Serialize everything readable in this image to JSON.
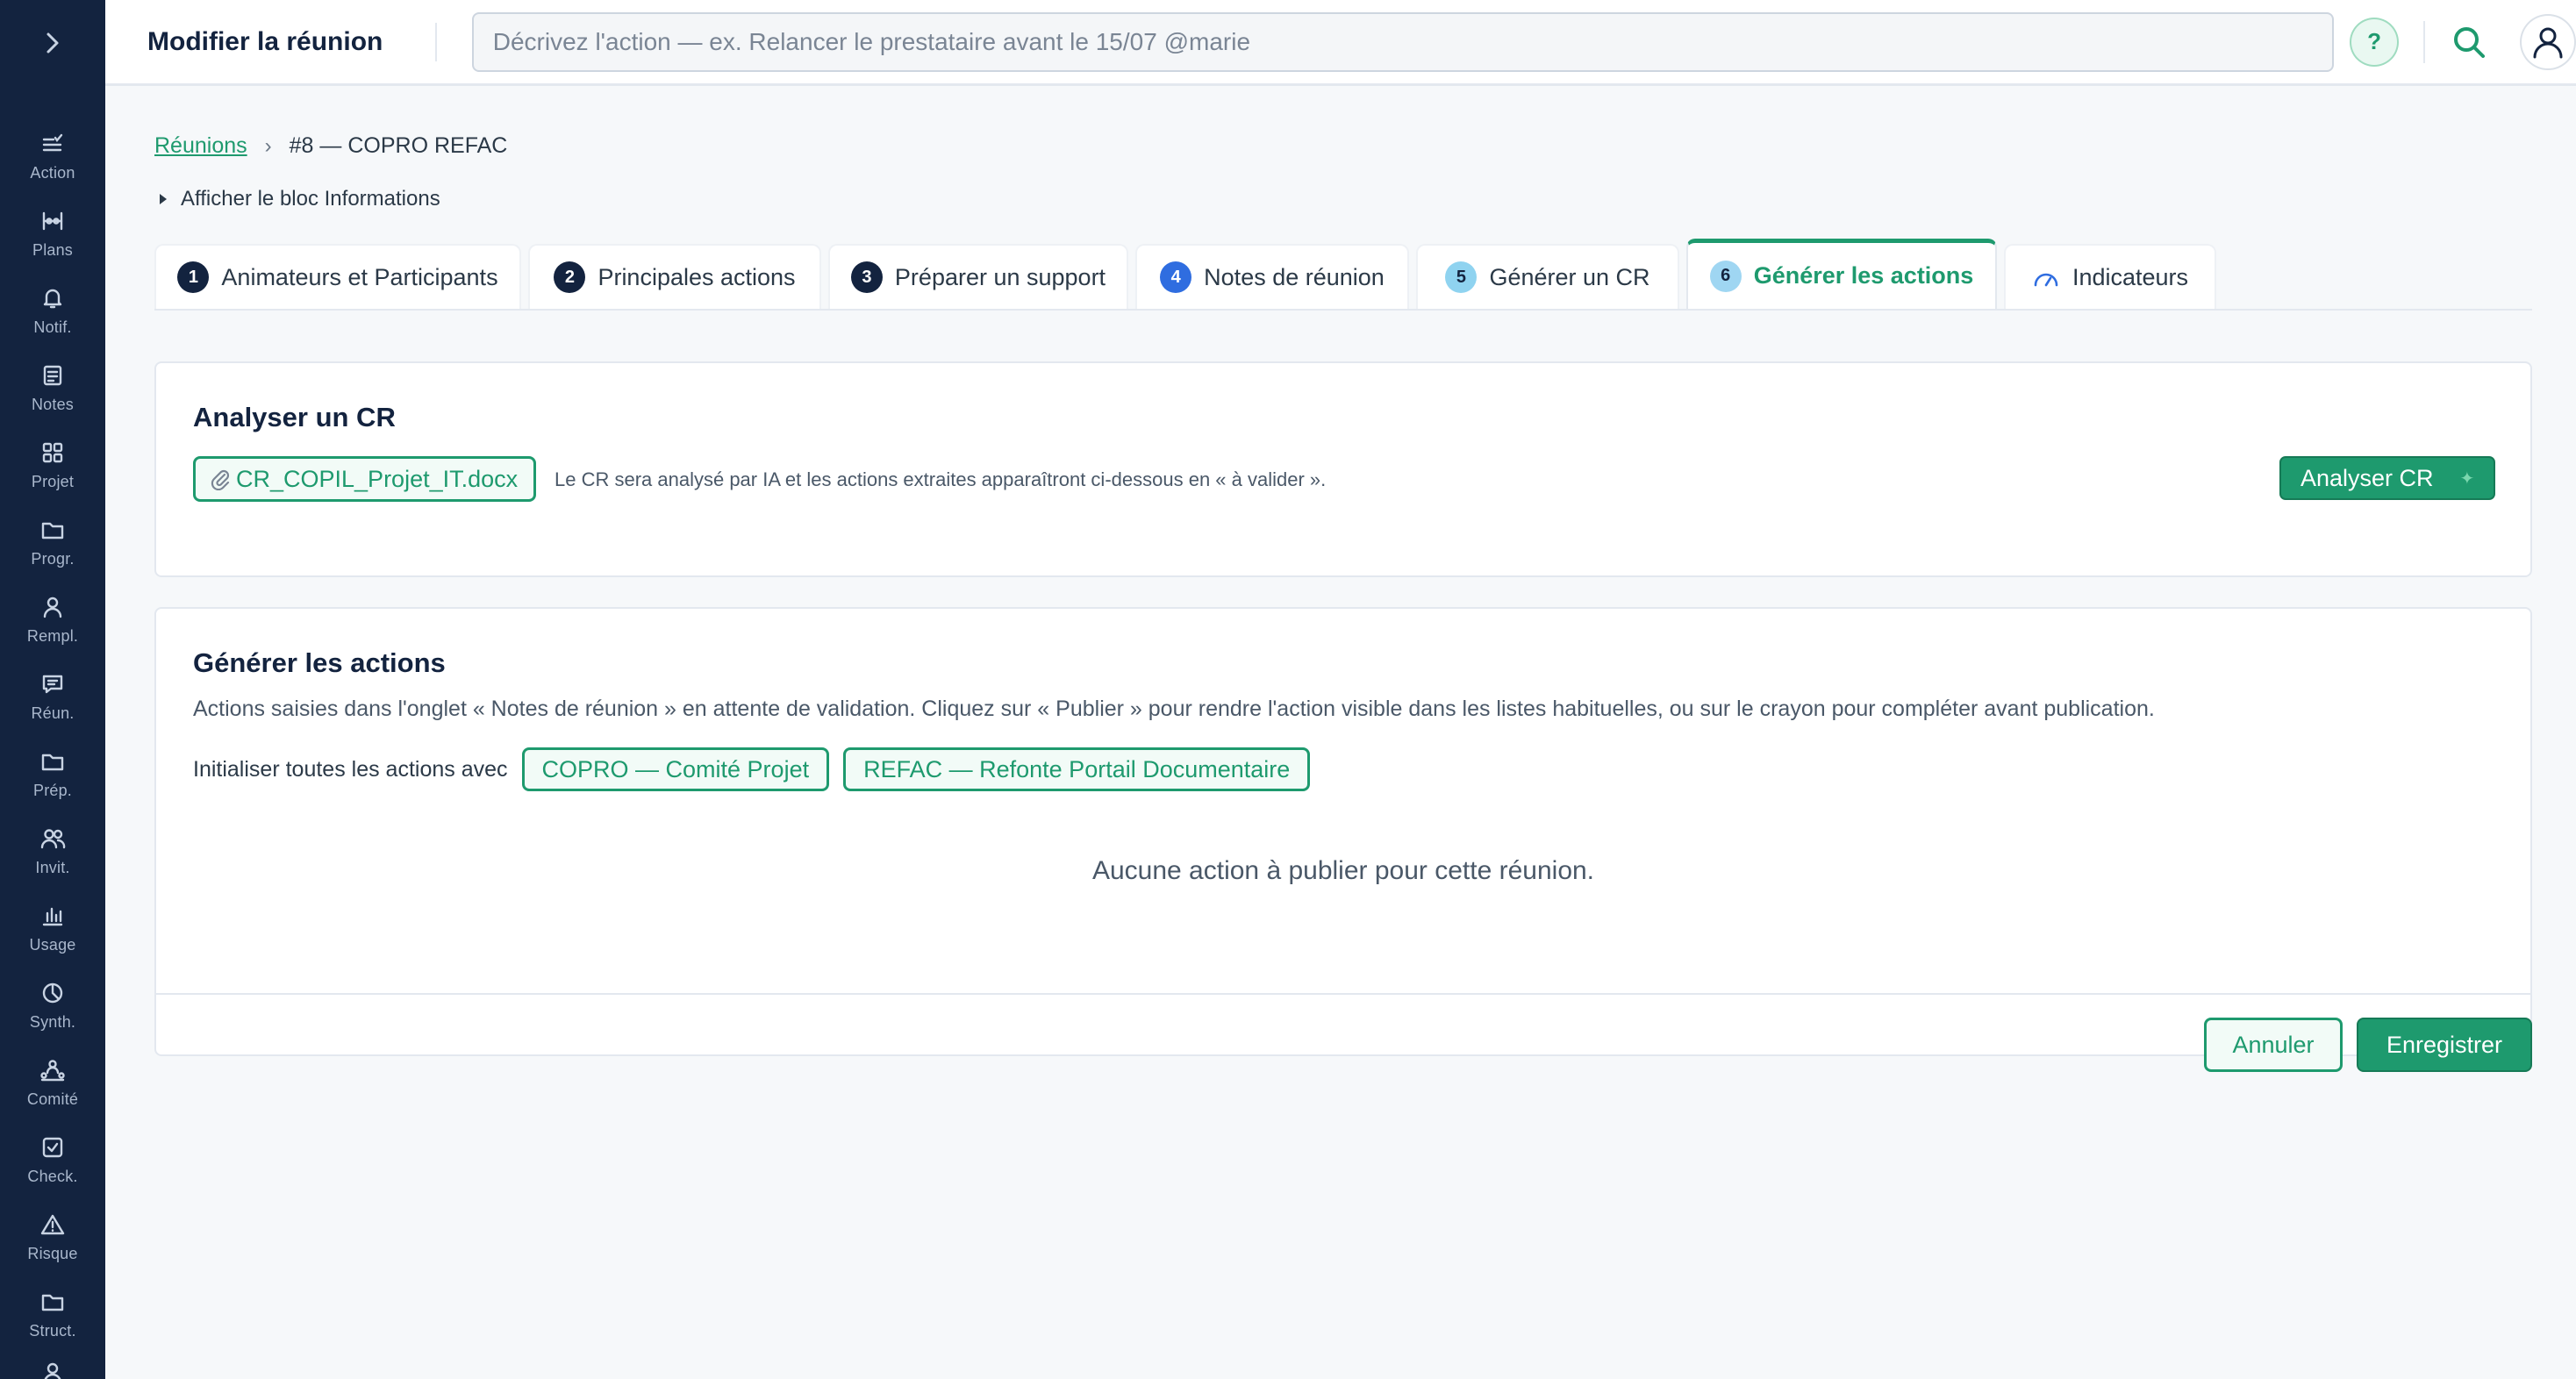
{
  "colors": {
    "sidebar_bg": "#13233f",
    "accent": "#1e9a6e",
    "active_tab": "#1e9a6e"
  },
  "sidebar": {
    "toggle_icon": "chevron-right-icon",
    "items": [
      {
        "label": "Action",
        "icon": "action-icon"
      },
      {
        "label": "Plans",
        "icon": "plans-icon"
      },
      {
        "label": "Notif.",
        "icon": "bell-icon"
      },
      {
        "label": "Notes",
        "icon": "notes-icon"
      },
      {
        "label": "Projet",
        "icon": "grid-icon"
      },
      {
        "label": "Progr.",
        "icon": "folder-icon"
      },
      {
        "label": "Rempl.",
        "icon": "person-icon"
      },
      {
        "label": "Réun.",
        "icon": "chat-icon"
      },
      {
        "label": "Prép.",
        "icon": "folder-icon"
      },
      {
        "label": "Invit.",
        "icon": "people-icon"
      },
      {
        "label": "Usage",
        "icon": "bar-chart-icon"
      },
      {
        "label": "Synth.",
        "icon": "pie-icon"
      },
      {
        "label": "Comité",
        "icon": "committee-icon"
      },
      {
        "label": "Check.",
        "icon": "checkbox-icon"
      },
      {
        "label": "Risque",
        "icon": "warning-icon"
      },
      {
        "label": "Struct.",
        "icon": "folder-icon"
      }
    ]
  },
  "header": {
    "title": "Modifier la réunion",
    "search_placeholder": "Décrivez l'action — ex. Relancer le prestataire avant le 15/07 @marie",
    "help_label": "?"
  },
  "breadcrumb": {
    "parent": "Réunions",
    "separator": "›",
    "current": "#8 — COPRO REFAC"
  },
  "info_toggle": "Afficher le bloc Informations",
  "tabs": [
    {
      "num": "1",
      "label": "Animateurs et Participants"
    },
    {
      "num": "2",
      "label": "Principales actions"
    },
    {
      "num": "3",
      "label": "Préparer un support"
    },
    {
      "num": "4",
      "label": "Notes de réunion"
    },
    {
      "num": "5",
      "label": "Générer un CR"
    },
    {
      "num": "6",
      "label": "Générer les actions",
      "active": true
    },
    {
      "icon": "gauge-icon",
      "label": "Indicateurs"
    }
  ],
  "analyse": {
    "title": "Analyser un CR",
    "file_name": "CR_COPIL_Projet_IT.docx",
    "hint": "Le CR sera analysé par IA et les actions extraites apparaîtront ci-dessous en « à valider ».",
    "button_label": "Analyser CR"
  },
  "generate": {
    "title": "Générer les actions",
    "description": "Actions saisies dans l'onglet « Notes de réunion » en attente de validation. Cliquez sur « Publier » pour rendre l'action visible dans les listes habituelles, ou sur le crayon pour compléter avant publication.",
    "init_label": "Initialiser toutes les actions avec",
    "tags": [
      "COPRO — Comité Projet",
      "REFAC — Refonte Portail Documentaire"
    ],
    "empty_message": "Aucune action à publier pour cette réunion."
  },
  "footer": {
    "cancel_label": "Annuler",
    "save_label": "Enregistrer"
  }
}
